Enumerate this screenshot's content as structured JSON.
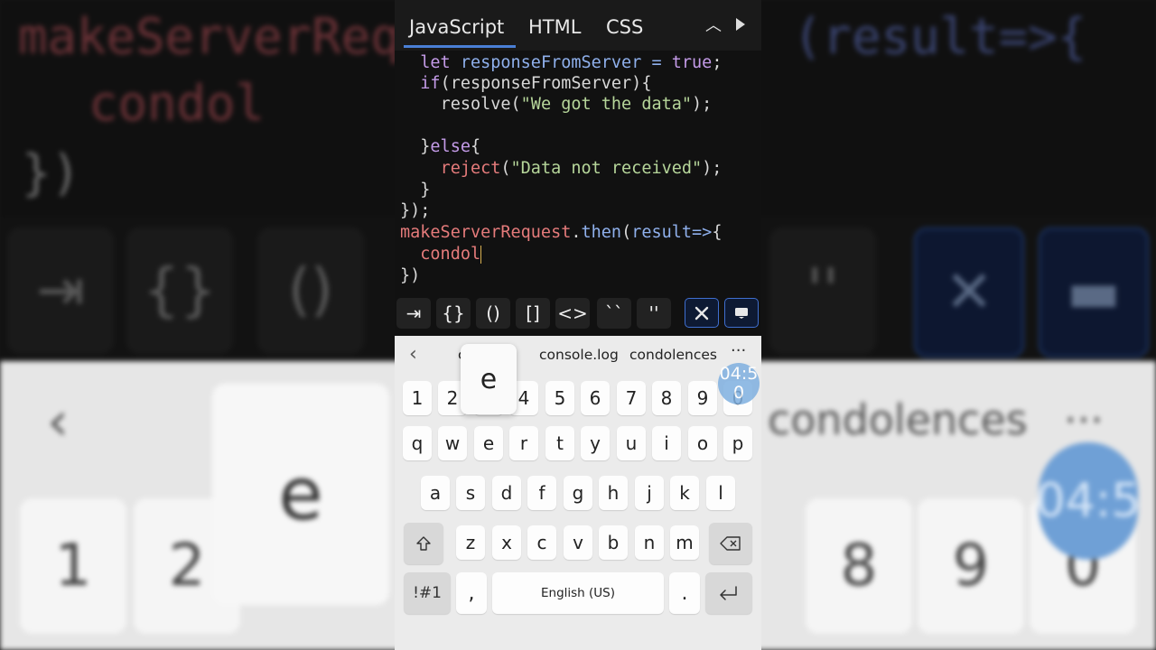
{
  "editor": {
    "tabs": [
      "JavaScript",
      "HTML",
      "CSS"
    ],
    "collapse_icon": "chevron-up-icon",
    "run_icon": "play-icon",
    "lines": {
      "l1": {
        "kw": "let ",
        "var": "responseFromServer",
        "op": " = ",
        "val": "true",
        "end": ";"
      },
      "l2": {
        "kw": "if",
        "rest": "(responseFromServer){"
      },
      "l3": {
        "fn": "resolve",
        "open": "(",
        "str": "\"We got the data\"",
        "close": ");"
      },
      "l5": {
        "brace": "}",
        "kw": "else",
        "open": "{"
      },
      "l6": {
        "fn": "reject",
        "open": "(",
        "str": "\"Data not received\"",
        "close": ");"
      },
      "l7": "}",
      "l8": "});",
      "l9": {
        "name": "makeServerRequest",
        "dot": ".",
        "fn": "then",
        "open": "(",
        "arg": "result=>",
        "brace": "{"
      },
      "l10": "condol",
      "l11": "})"
    }
  },
  "symbols": [
    "⇥",
    "{}",
    "()",
    "[]",
    "<>",
    "``",
    "''"
  ],
  "symbol_icons": {
    "tools": "tools-icon",
    "keyboard": "keyboard-icon"
  },
  "keyboard": {
    "suggestions": [
      "c",
      "console.log",
      "condolences"
    ],
    "more": "···",
    "numbers": [
      "1",
      "2",
      "3",
      "4",
      "5",
      "6",
      "7",
      "8",
      "9",
      "0"
    ],
    "row1": [
      "q",
      "w",
      "e",
      "r",
      "t",
      "y",
      "u",
      "i",
      "o",
      "p"
    ],
    "row2": [
      "a",
      "s",
      "d",
      "f",
      "g",
      "h",
      "j",
      "k",
      "l"
    ],
    "row3": [
      "z",
      "x",
      "c",
      "v",
      "b",
      "n",
      "m"
    ],
    "symbols_key": "!#1",
    "comma": ",",
    "space": "English (US)",
    "period": ".",
    "popup_key": "e",
    "timer_badge": "04:5\n0"
  }
}
